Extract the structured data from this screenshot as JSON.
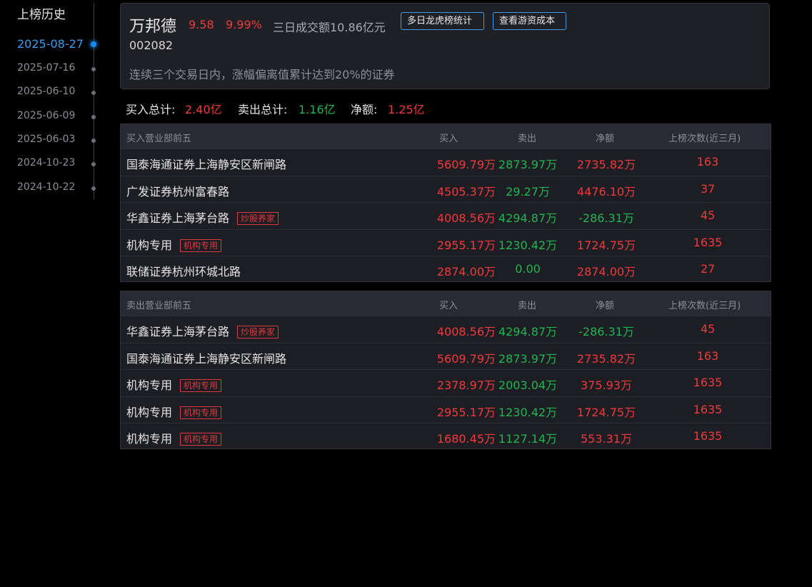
{
  "sidebar": {
    "title": "上榜历史",
    "dates": [
      {
        "label": "2025-08-27",
        "active": true
      },
      {
        "label": "2025-07-16",
        "active": false
      },
      {
        "label": "2025-06-10",
        "active": false
      },
      {
        "label": "2025-06-09",
        "active": false
      },
      {
        "label": "2025-06-03",
        "active": false
      },
      {
        "label": "2024-10-23",
        "active": false
      },
      {
        "label": "2024-10-22",
        "active": false
      }
    ]
  },
  "stock": {
    "name": "万邦德",
    "price": "9.58",
    "change_pct": "9.99%",
    "volume_text": "三日成交额10.86亿元",
    "code": "002082",
    "reason": "连续三个交易日内，涨幅偏离值累计达到20%的证券"
  },
  "buttons": {
    "multi_day": "多日龙虎榜统计",
    "hot_money_cost": "查看游资成本"
  },
  "summary": {
    "buy_label": "买入总计:",
    "buy_value": "2.40亿",
    "sell_label": "卖出总计:",
    "sell_value": "1.16亿",
    "net_label": "净额:",
    "net_value": "1.25亿"
  },
  "buy_table": {
    "headers": [
      "买入营业部前五",
      "买入",
      "卖出",
      "净额",
      "上榜次数(近三月)"
    ],
    "rows": [
      {
        "name": "国泰海通证券上海静安区新闸路",
        "tag": "",
        "buy": "5609.79万",
        "sell": "2873.97万",
        "net": "2735.82万",
        "net_positive": true,
        "count": "163"
      },
      {
        "name": "广发证券杭州富春路",
        "tag": "",
        "buy": "4505.37万",
        "sell": "29.27万",
        "net": "4476.10万",
        "net_positive": true,
        "count": "37"
      },
      {
        "name": "华鑫证券上海茅台路",
        "tag": "炒股养家",
        "buy": "4008.56万",
        "sell": "4294.87万",
        "net": "-286.31万",
        "net_positive": false,
        "count": "45"
      },
      {
        "name": "机构专用",
        "tag": "机构专用",
        "buy": "2955.17万",
        "sell": "1230.42万",
        "net": "1724.75万",
        "net_positive": true,
        "count": "1635"
      },
      {
        "name": "联储证券杭州环城北路",
        "tag": "",
        "buy": "2874.00万",
        "sell": "0.00",
        "net": "2874.00万",
        "net_positive": true,
        "count": "27"
      }
    ]
  },
  "sell_table": {
    "headers": [
      "卖出营业部前五",
      "买入",
      "卖出",
      "净额",
      "上榜次数(近三月)"
    ],
    "rows": [
      {
        "name": "华鑫证券上海茅台路",
        "tag": "炒股养家",
        "buy": "4008.56万",
        "sell": "4294.87万",
        "net": "-286.31万",
        "net_positive": false,
        "count": "45"
      },
      {
        "name": "国泰海通证券上海静安区新闸路",
        "tag": "",
        "buy": "5609.79万",
        "sell": "2873.97万",
        "net": "2735.82万",
        "net_positive": true,
        "count": "163"
      },
      {
        "name": "机构专用",
        "tag": "机构专用",
        "buy": "2378.97万",
        "sell": "2003.04万",
        "net": "375.93万",
        "net_positive": true,
        "count": "1635"
      },
      {
        "name": "机构专用",
        "tag": "机构专用",
        "buy": "2955.17万",
        "sell": "1230.42万",
        "net": "1724.75万",
        "net_positive": true,
        "count": "1635"
      },
      {
        "name": "机构专用",
        "tag": "机构专用",
        "buy": "1680.45万",
        "sell": "1127.14万",
        "net": "553.31万",
        "net_positive": true,
        "count": "1635"
      }
    ]
  },
  "colors": {
    "up": "#f0393d",
    "down": "#1fb553",
    "accent": "#3d9be9"
  }
}
